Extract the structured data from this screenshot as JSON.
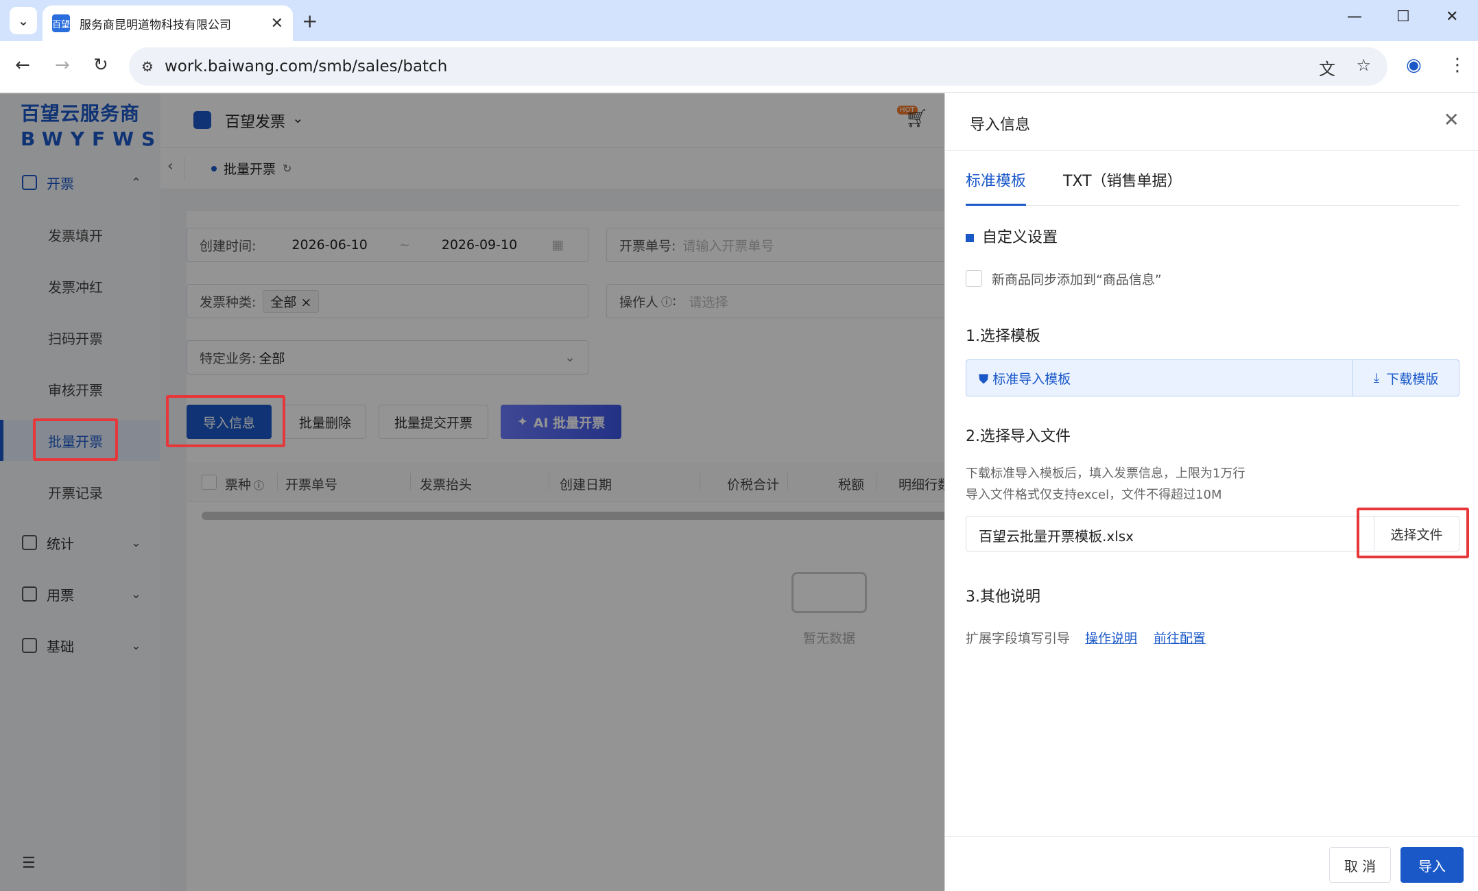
{
  "browser": {
    "tab_title": "服务商昆明道物科技有限公司",
    "tab_favicon": "百望",
    "url": "work.baiwang.com/smb/sales/batch"
  },
  "sidebar": {
    "brand_cn": "百望云服务商",
    "brand_en": "BWYFWS",
    "sections": {
      "invoice": "开票",
      "stats": "统计",
      "usage": "用票",
      "basic": "基础"
    },
    "items": [
      "发票填开",
      "发票冲红",
      "扫码开票",
      "审核开票",
      "批量开票",
      "开票记录"
    ],
    "selected": "批量开票"
  },
  "header": {
    "app_name": "百望发票",
    "hot_badge": "HOT"
  },
  "breadcrumb": {
    "current": "批量开票"
  },
  "filters": {
    "created_label": "创建时间:",
    "date_from": "2026-06-10",
    "date_sep": "~",
    "date_to": "2026-09-10",
    "order_no_label": "开票单号:",
    "order_no_placeholder": "请输入开票单号",
    "invoice_type_label": "发票种类:",
    "invoice_type_tag": "全部",
    "operator_label": "操作人",
    "operator_placeholder": "请选择",
    "business_label": "特定业务:",
    "business_value": "全部"
  },
  "toolbar": {
    "import": "导入信息",
    "batch_delete": "批量删除",
    "batch_submit": "批量提交开票",
    "ai_batch": "AI 批量开票"
  },
  "table": {
    "columns": [
      "票种",
      "开票单号",
      "发票抬头",
      "创建日期",
      "价税合计",
      "税额",
      "明细行数"
    ],
    "empty_text": "暂无数据"
  },
  "drawer": {
    "title": "导入信息",
    "tabs": [
      "标准模板",
      "TXT（销售单据）"
    ],
    "custom_title": "自定义设置",
    "sync_checkbox_label": "新商品同步添加到“商品信息”",
    "step1_title": "1.选择模板",
    "template_name": "标准导入模板",
    "download_label": "下载模版",
    "step2_title": "2.选择导入文件",
    "hint1": "下载标准导入模板后，填入发票信息，上限为1万行",
    "hint2": "导入文件格式仅支持excel，文件不得超过10M",
    "file_name": "百望云批量开票模板.xlsx",
    "choose_file": "选择文件",
    "step3_title": "3.其他说明",
    "ext_label": "扩展字段填写引导",
    "link_ops": "操作说明",
    "link_config": "前往配置",
    "cancel": "取 消",
    "import": "导入"
  },
  "colors": {
    "primary": "#1a58c8",
    "highlight": "#e6383a",
    "ai_gradient_start": "#6b7cff",
    "ai_gradient_end": "#3e56e6"
  }
}
